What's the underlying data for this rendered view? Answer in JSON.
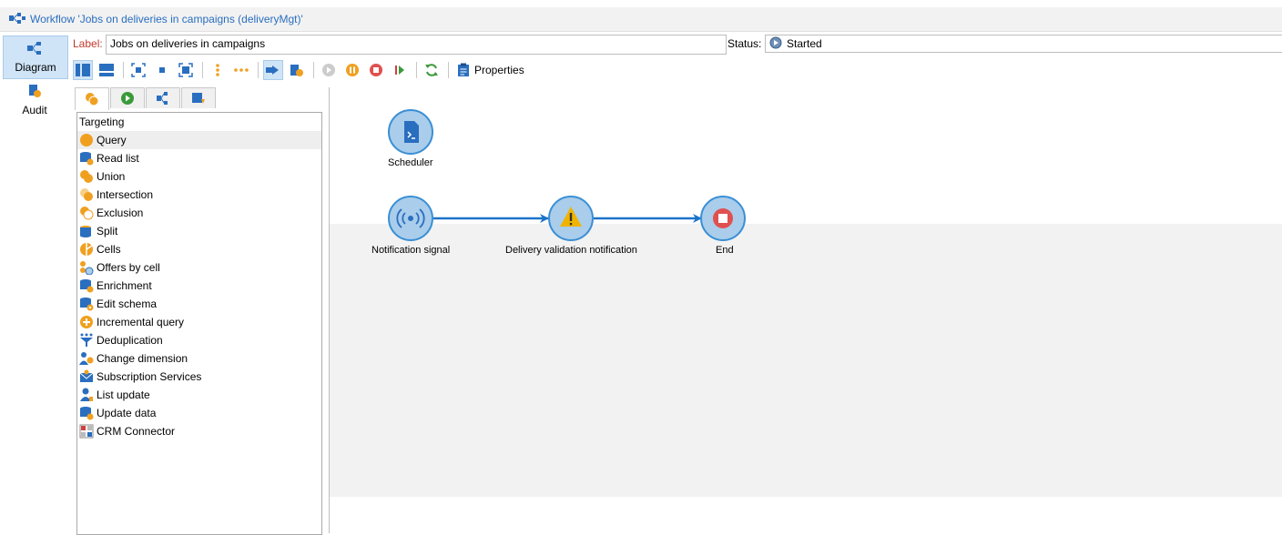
{
  "window": {
    "title": "Workflow 'Jobs on deliveries in campaigns (deliveryMgt)'"
  },
  "left_tabs": [
    {
      "label": "Diagram",
      "active": true
    },
    {
      "label": "Audit",
      "active": false
    }
  ],
  "form": {
    "label_caption": "Label:",
    "label_value": "Jobs on deliveries in campaigns",
    "status_caption": "Status:",
    "status_value": "Started"
  },
  "toolbar": {
    "properties_label": "Properties"
  },
  "palette": {
    "section": "Targeting",
    "items": [
      {
        "label": "Query",
        "icon": "query-icon"
      },
      {
        "label": "Read list",
        "icon": "read-list-icon"
      },
      {
        "label": "Union",
        "icon": "union-icon"
      },
      {
        "label": "Intersection",
        "icon": "intersection-icon"
      },
      {
        "label": "Exclusion",
        "icon": "exclusion-icon"
      },
      {
        "label": "Split",
        "icon": "split-icon"
      },
      {
        "label": "Cells",
        "icon": "cells-icon"
      },
      {
        "label": "Offers by cell",
        "icon": "offers-by-cell-icon"
      },
      {
        "label": "Enrichment",
        "icon": "enrichment-icon"
      },
      {
        "label": "Edit schema",
        "icon": "edit-schema-icon"
      },
      {
        "label": "Incremental query",
        "icon": "incremental-query-icon"
      },
      {
        "label": "Deduplication",
        "icon": "deduplication-icon"
      },
      {
        "label": "Change dimension",
        "icon": "change-dimension-icon"
      },
      {
        "label": "Subscription Services",
        "icon": "subscription-services-icon"
      },
      {
        "label": "List update",
        "icon": "list-update-icon"
      },
      {
        "label": "Update data",
        "icon": "update-data-icon"
      },
      {
        "label": "CRM Connector",
        "icon": "crm-connector-icon"
      }
    ]
  },
  "diagram": {
    "nodes": [
      {
        "label": "Scheduler",
        "icon": "scheduler-icon"
      },
      {
        "label": "Notification signal",
        "icon": "signal-icon"
      },
      {
        "label": "Delivery validation notification",
        "icon": "warning-icon"
      },
      {
        "label": "End",
        "icon": "stop-icon"
      }
    ]
  },
  "colors": {
    "accent": "#2a6ebf",
    "node_fill": "#a9cdeb",
    "node_border": "#3b8fd4",
    "orange": "#f0a020",
    "label_red": "#c0392b"
  }
}
